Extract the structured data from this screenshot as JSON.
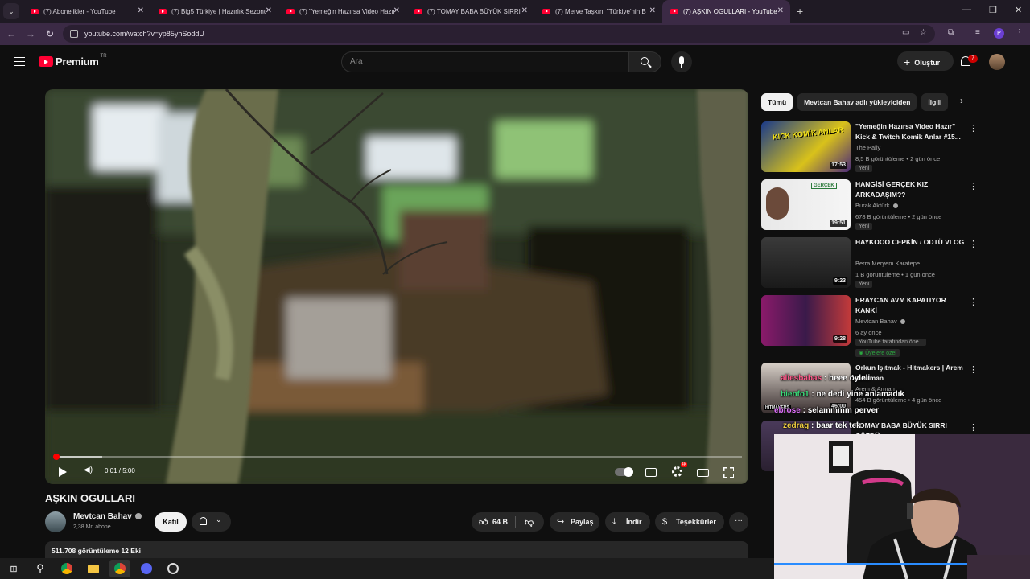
{
  "browser": {
    "tabs": [
      {
        "title": "(7) Abonelikler - YouTube"
      },
      {
        "title": "(7) Big5 Türkiye | Hazırlık Sezonu"
      },
      {
        "title": "(7) \"Yemeğin Hazırsa Video Hazır\""
      },
      {
        "title": "(7) TOMAY BABA BÜYÜK SIRRI Ç"
      },
      {
        "title": "(7) Merve Taşkın: \"Türkiye'nin B"
      },
      {
        "title": "(7) AŞKIN OGULLARI - YouTube"
      }
    ],
    "active_tab": 5,
    "url": "youtube.com/watch?v=yp85yhSoddU",
    "profile_letter": "P"
  },
  "header": {
    "logo_text": "Premium",
    "region": "TR",
    "search_placeholder": "Ara",
    "create_label": "Oluştur",
    "notification_count": "7"
  },
  "player": {
    "time": "0:01 / 5:00",
    "progress": 0.003,
    "buffer": 0.07,
    "hd_label": "4K"
  },
  "video": {
    "title": "AŞKIN OGULLARI",
    "channel": "Mevtcan Bahav",
    "subscribers": "2,38 Mn abone",
    "join_label": "Katıl",
    "likes": "64 B",
    "share_label": "Paylaş",
    "download_label": "İndir",
    "thanks_label": "Teşekkürler",
    "views_date": "511.708 görüntüleme  12 Eki"
  },
  "chips": [
    "Tümü",
    "Mevtcan Bahav adlı yükleyiciden",
    "İlgili"
  ],
  "recommendations": [
    {
      "title": "\"Yemeğin Hazırsa Video Hazır\" Kick & Twitch Komik Anlar #15...",
      "channel": "The Pally",
      "meta": "8,5 B görüntüleme • 2 gün önce",
      "badge": "Yeni",
      "duration": "17:53",
      "thumb_text": "KICK KOMİK ANLAR"
    },
    {
      "title": "HANGİSİ GERÇEK KIZ ARKADAŞIM??",
      "channel": "Burak Aktürk",
      "meta": "678 B görüntüleme • 2 gün önce",
      "badge": "Yeni",
      "duration": "19:51",
      "thumb_text": "GERÇEK"
    },
    {
      "title": "HAYKOOO CEPKİN / ODTÜ VLOG",
      "channel": "Berra Meryem Karatepe",
      "meta": "1 B görüntüleme • 1 gün önce",
      "badge": "Yeni",
      "duration": "9:23",
      "thumb_text": ""
    },
    {
      "title": "ERAYCAN AVM KAPATIYOR KANKİ",
      "channel": "Mevtcan Bahav",
      "meta": "6 ay önce",
      "badge": "YouTube tarafından öne...",
      "badge2": "Üyelere özel",
      "duration": "9:28",
      "thumb_text": ""
    },
    {
      "title": "Orkun Işıtmak - Hitmakers | Arem & Arman",
      "channel": "Arem & Arman",
      "meta": "454 B görüntüleme • 4 gün önce",
      "duration": "46:00",
      "thumb_text": "HITMAKERS"
    },
    {
      "title": "TOMAY BABA BÜYÜK SIRRI ÇÖZDÜ",
      "channel": "",
      "meta": "",
      "duration": "",
      "thumb_text": ""
    }
  ],
  "chat_overlay": [
    {
      "user": "aliesbabas",
      "text": "heee öyleli"
    },
    {
      "user": "bienfo1",
      "text": "ne dedi yine anlamadık"
    },
    {
      "user": "ebrose",
      "text": "selammmm perver"
    },
    {
      "user": "zedrag",
      "text": "baar tek tek"
    }
  ],
  "colors": {
    "accent": "#ff0033",
    "browser_frame": "#3b2a45",
    "background": "#0f0f0f"
  },
  "taskbar": {
    "icons": [
      "windows-icon",
      "search-icon",
      "chrome-icon",
      "file-explorer-icon",
      "chrome-active-icon",
      "discord-icon",
      "obs-icon"
    ]
  }
}
